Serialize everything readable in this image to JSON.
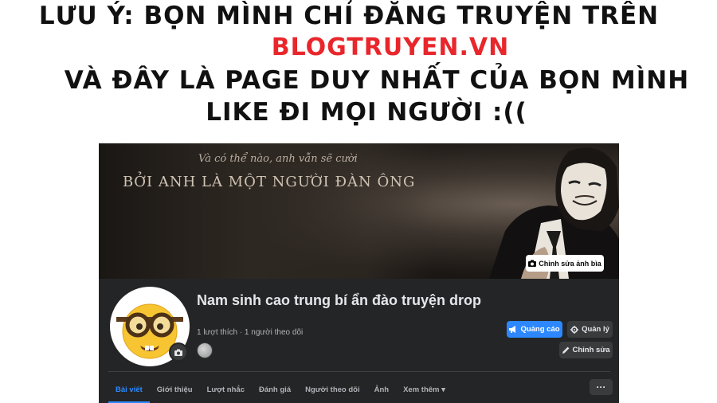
{
  "notice": {
    "line1": "LƯU Ý: BỌN MÌNH CHỈ ĐĂNG TRUYỆN TRÊN",
    "line2": "BLOGTRUYEN.VN",
    "line3": "VÀ ĐÂY LÀ PAGE DUY NHẤT CỦA BỌN MÌNH",
    "line4": "LIKE ĐI MỌI NGƯỜI :((",
    "highlight_color": "#e8262b"
  },
  "cover": {
    "quote_small": "Và có thể nào, anh vẫn sẽ cười",
    "quote_large": "BỞI ANH LÀ MỘT NGƯỜI ĐÀN ÔNG",
    "edit_cover_label": "Chỉnh sửa ảnh bìa"
  },
  "page": {
    "name": "Nam sinh cao trung bí ẩn đào truyện drop",
    "stats": "1 lượt thích · 1 người theo dõi"
  },
  "actions": {
    "ad_label": "Quảng cáo",
    "manage_label": "Quản lý",
    "edit_label": "Chỉnh sửa"
  },
  "tabs": [
    {
      "label": "Bài viết",
      "active": true
    },
    {
      "label": "Giới thiệu"
    },
    {
      "label": "Lượt nhắc"
    },
    {
      "label": "Đánh giá"
    },
    {
      "label": "Người theo dõi"
    },
    {
      "label": "Ảnh"
    },
    {
      "label": "Xem thêm"
    }
  ],
  "more_label": "···",
  "colors": {
    "accent": "#2d88ff",
    "panel_bg": "#242526",
    "button_bg": "#3a3b3c"
  },
  "icons": [
    "camera-icon",
    "megaphone-icon",
    "gear-icon",
    "pencil-icon",
    "caret-down-icon"
  ]
}
